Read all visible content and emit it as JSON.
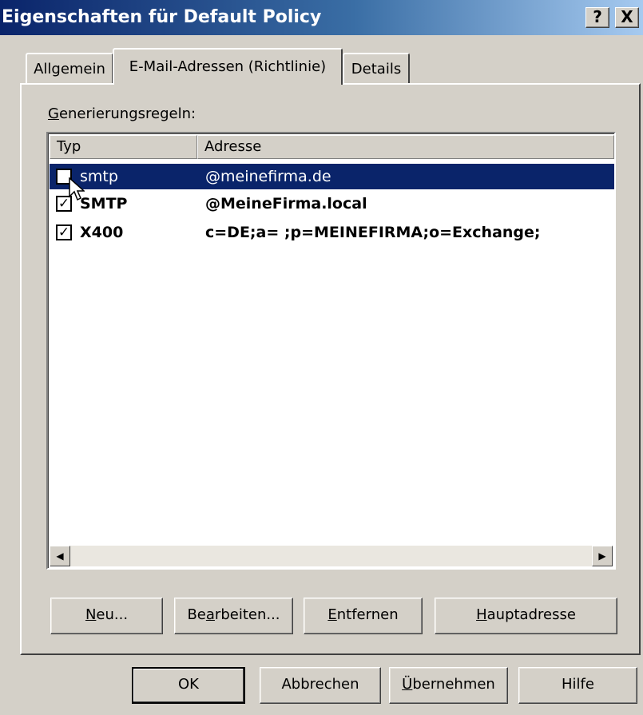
{
  "window": {
    "title": "Eigenschaften für Default Policy",
    "help_label": "?",
    "close_label": "X"
  },
  "tabs": [
    {
      "label": "Allgemein",
      "selected": false
    },
    {
      "label": "E-Mail-Adressen (Richtlinie)",
      "selected": true
    },
    {
      "label": "Details",
      "selected": false
    }
  ],
  "rules": {
    "label": "Generierungsregeln:",
    "mnemonic": "G",
    "label_rest": "enerierungsregeln:"
  },
  "list": {
    "columns": [
      "Typ",
      "Adresse"
    ],
    "rows": [
      {
        "type": "smtp",
        "address": "@meinefirma.de",
        "checked": false,
        "selected": true,
        "bold": false
      },
      {
        "type": "SMTP",
        "address": "@MeineFirma.local",
        "checked": true,
        "selected": false,
        "bold": true
      },
      {
        "type": "X400",
        "address": "c=DE;a= ;p=MEINEFIRMA;o=Exchange;",
        "checked": true,
        "selected": false,
        "bold": true
      }
    ]
  },
  "actions": {
    "new": {
      "pre": "",
      "mn": "N",
      "post": "eu..."
    },
    "edit": {
      "pre": "Be",
      "mn": "a",
      "post": "rbeiten..."
    },
    "remove": {
      "pre": "",
      "mn": "E",
      "post": "ntfernen"
    },
    "primary": {
      "pre": "",
      "mn": "H",
      "post": "auptadresse"
    }
  },
  "footer": {
    "ok": "OK",
    "cancel": "Abbrechen",
    "apply": {
      "pre": "",
      "mn": "Ü",
      "post": "bernehmen"
    },
    "help": "Hilfe"
  },
  "colors": {
    "face": "#d4d0c8",
    "selection": "#0a246a",
    "title_start": "#0a246a",
    "title_end": "#a6caf0"
  }
}
